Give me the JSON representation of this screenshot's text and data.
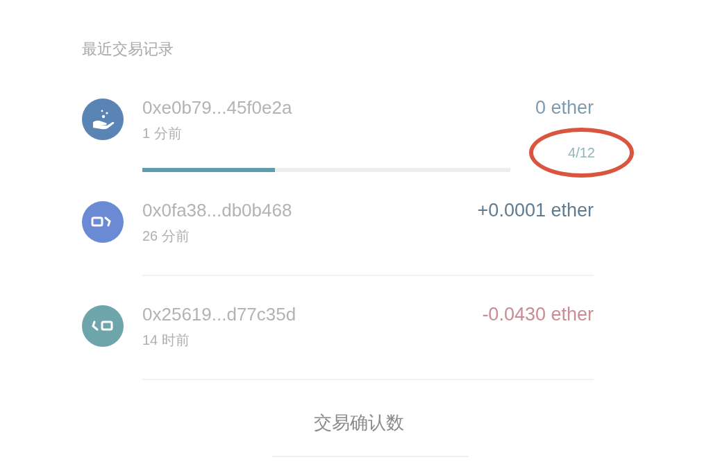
{
  "section_title": "最近交易记录",
  "transactions": [
    {
      "kind": "contract",
      "address": "0xe0b79...45f0e2a",
      "time": "1 分前",
      "amount": "0 ether",
      "color": "#7e9bb0",
      "confirmations": "4/12",
      "level": 0.36,
      "highlighted": true
    },
    {
      "kind": "incoming",
      "address": "0x0fa38...db0b468",
      "time": "26 分前",
      "amount": "+0.0001 ether",
      "color": "#5f7b90"
    },
    {
      "kind": "outgoing",
      "address": "0x25619...d77c35d",
      "time": "14 时前",
      "amount": "-0.0430 ether",
      "color": "#c98c93"
    }
  ],
  "caption": "交易确认数"
}
